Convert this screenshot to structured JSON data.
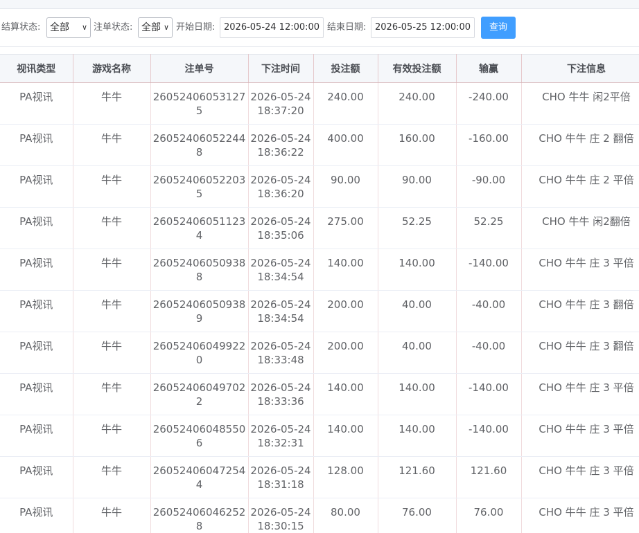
{
  "filter": {
    "settle_label": "结算状态:",
    "settle_value": "全部",
    "order_label": "注单状态:",
    "order_value": "全部",
    "start_label": "开始日期:",
    "start_value": "2026-05-24 12:00:00",
    "end_label": "结束日期:",
    "end_value": "2026-05-25 12:00:00",
    "query_label": "查询"
  },
  "table": {
    "headers": [
      "视讯类型",
      "游戏名称",
      "注单号",
      "下注时间",
      "投注额",
      "有效投注额",
      "输赢",
      "下注信息"
    ],
    "rows": [
      [
        "PA视讯",
        "牛牛",
        "260524060531275",
        "2026-05-24 18:37:20",
        "240.00",
        "240.00",
        "-240.00",
        "CHO 牛牛 闲2平倍"
      ],
      [
        "PA视讯",
        "牛牛",
        "260524060522448",
        "2026-05-24 18:36:22",
        "400.00",
        "160.00",
        "-160.00",
        "CHO 牛牛 庄 2 翻倍"
      ],
      [
        "PA视讯",
        "牛牛",
        "260524060522035",
        "2026-05-24 18:36:20",
        "90.00",
        "90.00",
        "-90.00",
        "CHO 牛牛 庄 2 平倍"
      ],
      [
        "PA视讯",
        "牛牛",
        "260524060511234",
        "2026-05-24 18:35:06",
        "275.00",
        "52.25",
        "52.25",
        "CHO 牛牛 闲2翻倍"
      ],
      [
        "PA视讯",
        "牛牛",
        "260524060509388",
        "2026-05-24 18:34:54",
        "140.00",
        "140.00",
        "-140.00",
        "CHO 牛牛 庄 3 平倍"
      ],
      [
        "PA视讯",
        "牛牛",
        "260524060509389",
        "2026-05-24 18:34:54",
        "200.00",
        "40.00",
        "-40.00",
        "CHO 牛牛 庄 3 翻倍"
      ],
      [
        "PA视讯",
        "牛牛",
        "260524060499220",
        "2026-05-24 18:33:48",
        "200.00",
        "40.00",
        "-40.00",
        "CHO 牛牛 庄 3 翻倍"
      ],
      [
        "PA视讯",
        "牛牛",
        "260524060497022",
        "2026-05-24 18:33:36",
        "140.00",
        "140.00",
        "-140.00",
        "CHO 牛牛 庄 3 平倍"
      ],
      [
        "PA视讯",
        "牛牛",
        "260524060485506",
        "2026-05-24 18:32:31",
        "140.00",
        "140.00",
        "-140.00",
        "CHO 牛牛 庄 3 平倍"
      ],
      [
        "PA视讯",
        "牛牛",
        "260524060472544",
        "2026-05-24 18:31:18",
        "128.00",
        "121.60",
        "121.60",
        "CHO 牛牛 庄 3 平倍"
      ],
      [
        "PA视讯",
        "牛牛",
        "260524060462528",
        "2026-05-24 18:30:15",
        "80.00",
        "76.00",
        "76.00",
        "CHO 牛牛 庄 3 平倍"
      ]
    ]
  },
  "colors": {
    "accent": "#409eff",
    "header_bg": "#f5f7fa",
    "text": "#606266"
  }
}
